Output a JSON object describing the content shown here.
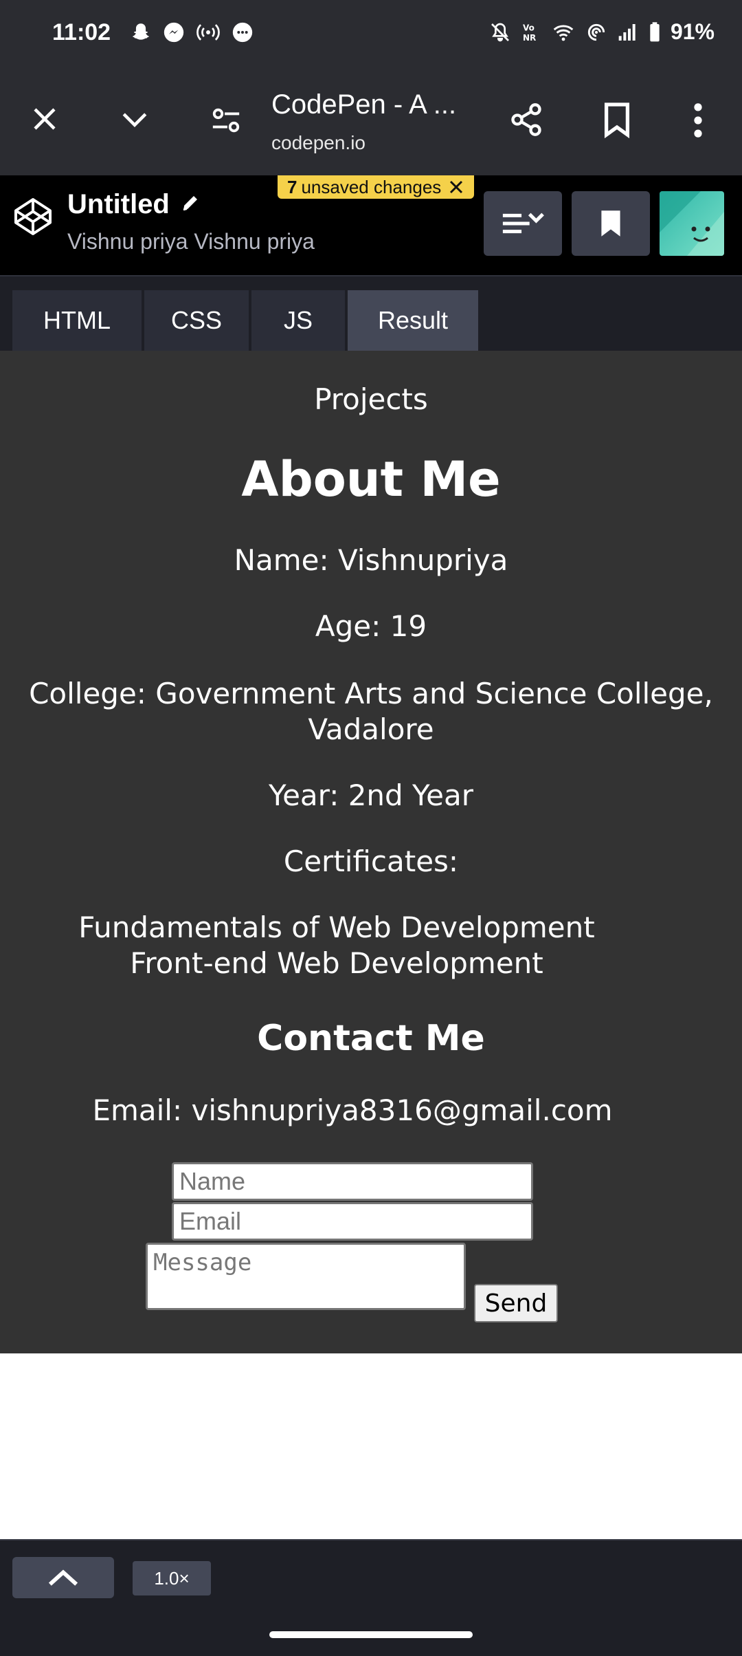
{
  "status_bar": {
    "time": "11:02",
    "battery": "91%",
    "left_icons": [
      "snapchat-icon",
      "messenger-icon",
      "hotspot-icon",
      "chat-bubble-icon"
    ],
    "right_icons": [
      "mute-icon",
      "vonr-icon",
      "wifi-icon",
      "nfc-icon",
      "signal-icon",
      "battery-icon"
    ]
  },
  "browser": {
    "page_title": "CodePen - A ...",
    "domain": "codepen.io"
  },
  "codepen": {
    "pen_title": "Untitled",
    "author": "Vishnu priya Vishnu priya",
    "unsaved_count": "7",
    "unsaved_text": "unsaved changes"
  },
  "tabs": [
    {
      "label": "HTML",
      "active": false
    },
    {
      "label": "CSS",
      "active": false
    },
    {
      "label": "JS",
      "active": false
    },
    {
      "label": "Result",
      "active": true
    }
  ],
  "result": {
    "projects_link": "Projects",
    "about_heading": "About Me",
    "name": "Name: Vishnupriya",
    "age": "Age: 19",
    "college_line1": "College: Government Arts and Science College,",
    "college_line2": "Vadalore",
    "year": "Year: 2nd Year",
    "certificates_label": "Certificates:",
    "certificates": [
      "Fundamentals of Web Development",
      "Front-end Web Development"
    ],
    "contact_heading": "Contact Me",
    "email_line": "Email: vishnupriya8316@gmail.com",
    "form": {
      "name_placeholder": "Name",
      "email_placeholder": "Email",
      "message_placeholder": "Message",
      "send_label": "Send"
    }
  },
  "bottom": {
    "zoom": "1.0×"
  },
  "colors": {
    "chrome_bg": "#2b2c31",
    "codepen_header_bg": "#000000",
    "result_bg": "#333333",
    "badge_yellow": "#f5d14a",
    "tab_active": "#444857"
  }
}
